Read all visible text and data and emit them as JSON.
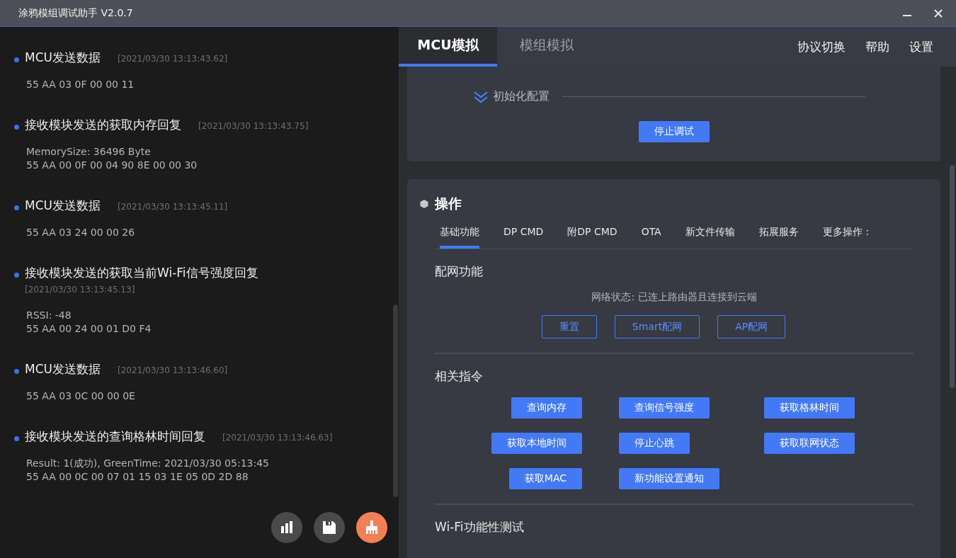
{
  "window": {
    "title": "涂鸦模组调试助手 V2.0.7"
  },
  "log": {
    "entries": [
      {
        "title": "MCU发送数据",
        "time": "[2021/03/30 13:13:43.62]",
        "lines": [
          "55 AA 03 0F 00 00 11"
        ]
      },
      {
        "title": "接收模块发送的获取内存回复",
        "time": "[2021/03/30 13:13:43.75]",
        "lines": [
          "MemorySize: 36496 Byte",
          "55 AA 00 0F 00 04 90 8E 00 00 30"
        ]
      },
      {
        "title": "MCU发送数据",
        "time": "[2021/03/30 13:13:45.11]",
        "lines": [
          "55 AA 03 24 00 00 26"
        ]
      },
      {
        "title": "接收模块发送的获取当前Wi-Fi信号强度回复",
        "time": "[2021/03/30 13:13:45.13]",
        "lines": [
          "RSSI: -48",
          "55 AA 00 24 00 01 D0 F4"
        ]
      },
      {
        "title": "MCU发送数据",
        "time": "[2021/03/30 13:13:46.60]",
        "lines": [
          "55 AA 03 0C 00 00 0E"
        ]
      },
      {
        "title": "接收模块发送的查询格林时间回复",
        "time": "[2021/03/30 13:13:46.63]",
        "lines": [
          "Result: 1(成功), GreenTime: 2021/03/30 05:13:45",
          "55 AA 00 0C 00 07 01 15 03 1E 05 0D 2D 88"
        ]
      }
    ],
    "actions": [
      {
        "kind": "chart"
      },
      {
        "kind": "save"
      },
      {
        "kind": "clear"
      }
    ]
  },
  "mode_tabs": [
    {
      "label": "MCU模拟",
      "selected": true
    },
    {
      "label": "模组模拟",
      "selected": false
    }
  ],
  "menu": [
    "协议切换",
    "帮助",
    "设置"
  ],
  "init_card": {
    "section": "初始化配置",
    "button": "停止调试"
  },
  "operations": {
    "title": "操作",
    "tabs": [
      {
        "label": "基础功能",
        "selected": true
      },
      {
        "label": "DP CMD",
        "selected": false
      },
      {
        "label": "附DP CMD",
        "selected": false
      },
      {
        "label": "OTA",
        "selected": false
      },
      {
        "label": "新文件传输",
        "selected": false
      },
      {
        "label": "拓展服务",
        "selected": false
      },
      {
        "label": "更多操作：",
        "selected": false
      }
    ],
    "network": {
      "title": "配网功能",
      "status": "网络状态: 已连上路由器且连接到云端",
      "buttons": [
        "重置",
        "Smart配网",
        "AP配网"
      ]
    },
    "commands": {
      "title": "相关指令",
      "buttons": [
        "查询内存",
        "查询信号强度",
        "获取格林时间",
        "获取本地时间",
        "停止心跳",
        "获取联网状态",
        "获取MAC",
        "新功能设置通知"
      ]
    },
    "next_section": "Wi-Fi功能性测试"
  }
}
